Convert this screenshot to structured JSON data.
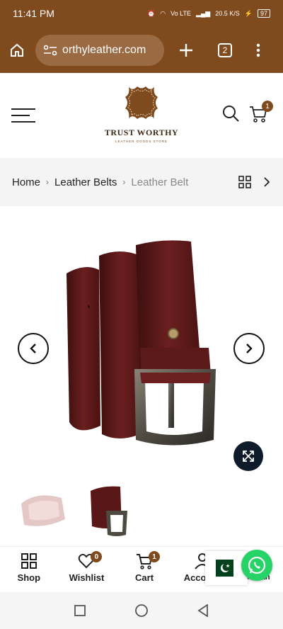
{
  "status": {
    "time": "11:41 PM",
    "network": "Vo LTE",
    "speed": "20.5 K/S",
    "battery": "97"
  },
  "browser": {
    "url": "orthyleather.com",
    "tabs_count": "2",
    "icons": [
      "home-icon",
      "tune-icon",
      "plus-icon",
      "tabs-icon",
      "more-icon"
    ]
  },
  "header": {
    "logo_title": "TRUST WORTHY",
    "logo_subtitle": "LEATHER GOODS STORE",
    "cart_count": "1"
  },
  "breadcrumb": {
    "items": [
      "Home",
      "Leather Belts",
      "Leather Belt"
    ]
  },
  "gallery": {
    "thumbnails": 2
  },
  "bottom_nav": {
    "items": [
      {
        "label": "Shop",
        "icon": "grid-icon"
      },
      {
        "label": "Wishlist",
        "icon": "heart-icon",
        "badge": "0"
      },
      {
        "label": "Cart",
        "icon": "cart-icon",
        "badge": "1"
      },
      {
        "label": "Account",
        "icon": "user-icon"
      }
    ],
    "partial_label": "Sautan"
  },
  "colors": {
    "brand": "#7e4a1e",
    "dark": "#0f1a2b",
    "whatsapp": "#25d366"
  }
}
